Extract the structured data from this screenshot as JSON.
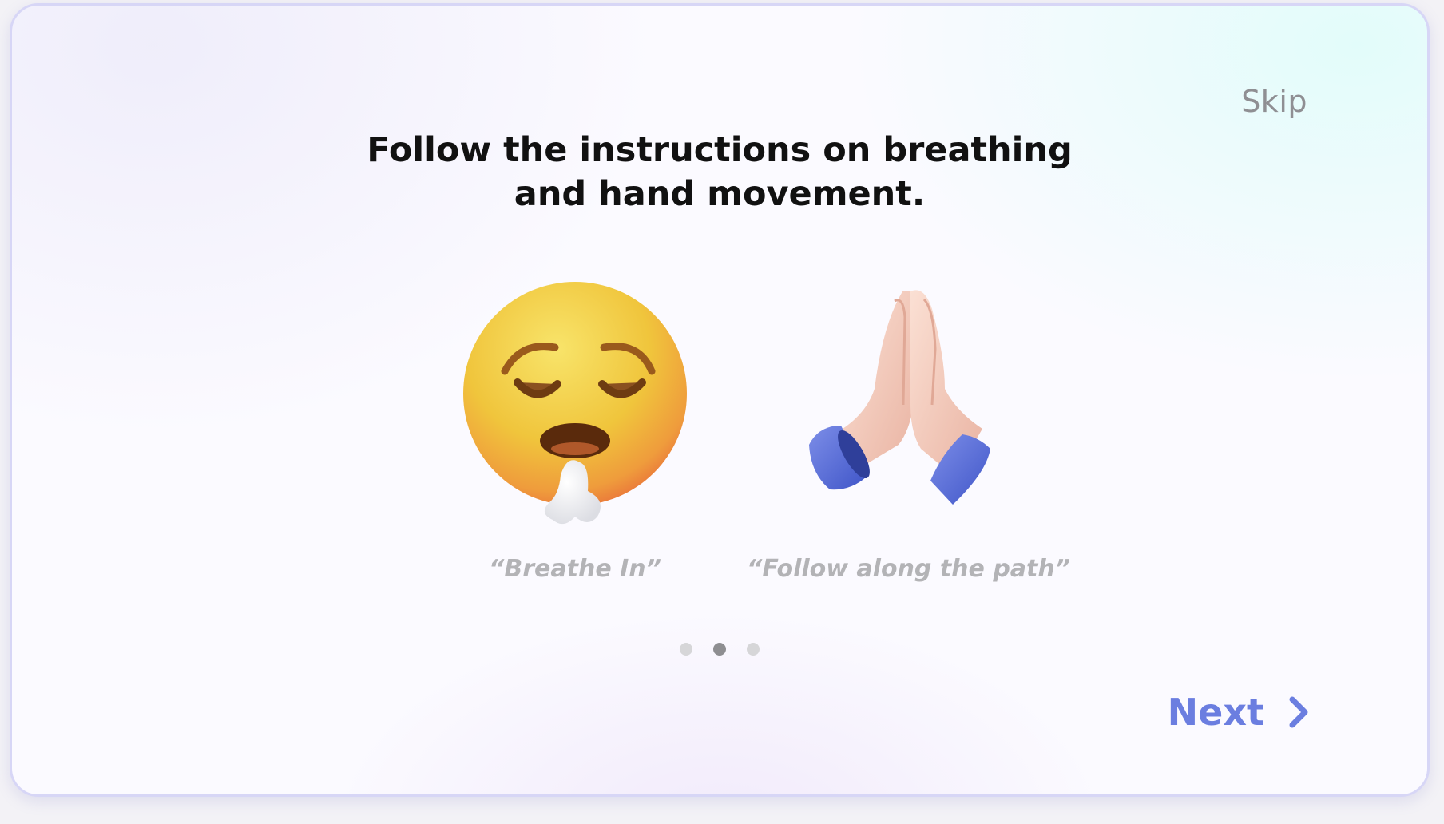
{
  "header": {
    "skip_label": "Skip"
  },
  "content": {
    "title_line1": "Follow the instructions on breathing",
    "title_line2": "and hand movement.",
    "items": [
      {
        "icon": "exhaling-face-icon",
        "caption": "“Breathe In”"
      },
      {
        "icon": "folded-hands-icon",
        "caption": "“Follow along the path”"
      }
    ]
  },
  "pagination": {
    "total": 3,
    "current": 2
  },
  "footer": {
    "next_label": "Next",
    "next_icon": "chevron-right-icon"
  },
  "colors": {
    "accent": "#6b7ee0",
    "title": "#111111",
    "caption": "#b3b3b6",
    "skip": "#8f8f93",
    "dot_active": "#8e8e91",
    "dot_inactive": "#d6d6d8",
    "card_border": "#d7d6f6"
  }
}
